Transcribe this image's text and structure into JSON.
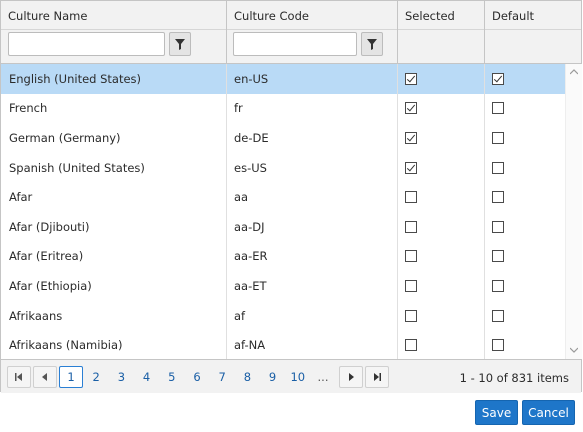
{
  "columns": {
    "culture_name": "Culture Name",
    "culture_code": "Culture Code",
    "selected": "Selected",
    "default": "Default"
  },
  "filters": {
    "culture_name_value": "",
    "culture_code_value": ""
  },
  "rows": [
    {
      "name": "English (United States)",
      "code": "en-US",
      "selected": true,
      "default": true,
      "highlight": true
    },
    {
      "name": "French",
      "code": "fr",
      "selected": true,
      "default": false
    },
    {
      "name": "German (Germany)",
      "code": "de-DE",
      "selected": true,
      "default": false
    },
    {
      "name": "Spanish (United States)",
      "code": "es-US",
      "selected": true,
      "default": false
    },
    {
      "name": "Afar",
      "code": "aa",
      "selected": false,
      "default": false
    },
    {
      "name": "Afar (Djibouti)",
      "code": "aa-DJ",
      "selected": false,
      "default": false
    },
    {
      "name": "Afar (Eritrea)",
      "code": "aa-ER",
      "selected": false,
      "default": false
    },
    {
      "name": "Afar (Ethiopia)",
      "code": "aa-ET",
      "selected": false,
      "default": false
    },
    {
      "name": "Afrikaans",
      "code": "af",
      "selected": false,
      "default": false
    },
    {
      "name": "Afrikaans (Namibia)",
      "code": "af-NA",
      "selected": false,
      "default": false
    }
  ],
  "pager": {
    "pages": [
      "1",
      "2",
      "3",
      "4",
      "5",
      "6",
      "7",
      "8",
      "9",
      "10",
      "..."
    ],
    "current": "1",
    "info": "1 - 10 of 831 items"
  },
  "actions": {
    "save": "Save",
    "cancel": "Cancel"
  },
  "colors": {
    "selected_row": "#b9daf6",
    "primary_button": "#1e76c9",
    "header_bg": "#f2f2f2"
  }
}
